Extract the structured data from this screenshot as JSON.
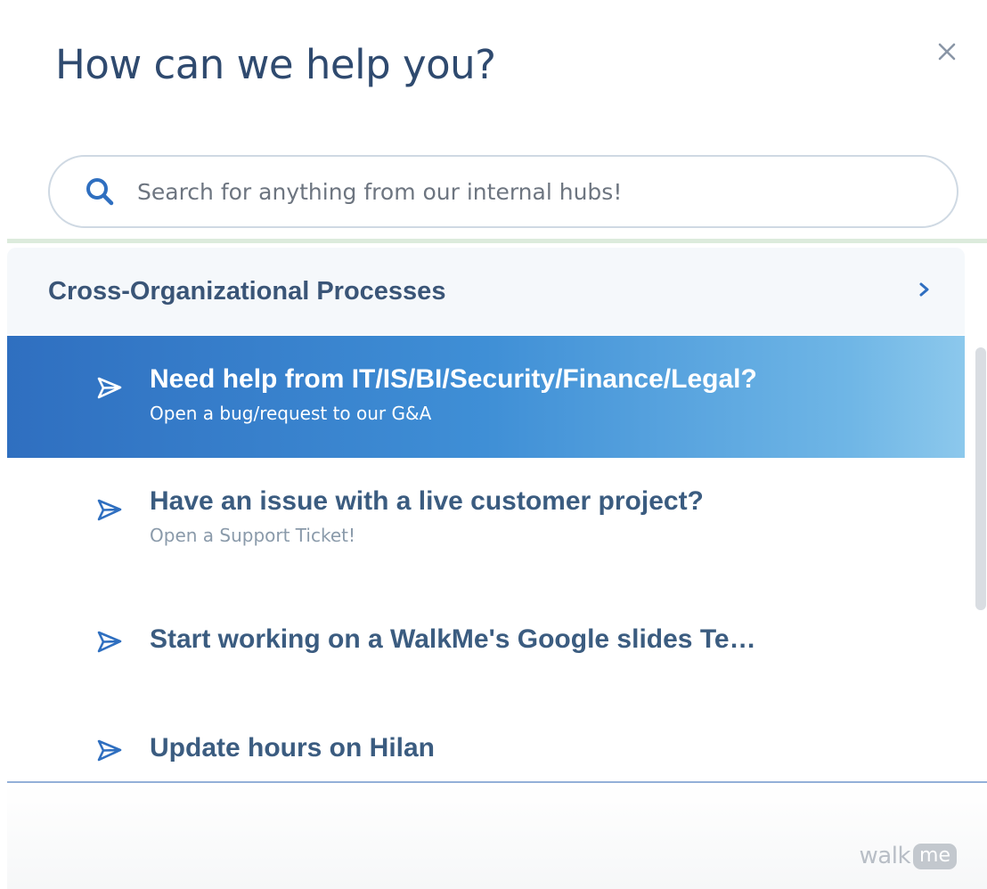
{
  "widget": {
    "title": "How can we help you?",
    "close_icon": "close-icon"
  },
  "search": {
    "placeholder": "Search for anything from our internal hubs!",
    "icon": "search-icon",
    "value": ""
  },
  "category": {
    "label": "Cross-Organizational Processes",
    "icon": "chevron-right-icon"
  },
  "items": [
    {
      "title": "Need help from IT/IS/BI/Security/Finance/Legal?",
      "subtitle": "Open a bug/request to our G&A",
      "active": true
    },
    {
      "title": "Have an issue with a live customer project?",
      "subtitle": "Open a Support Ticket!",
      "active": false
    },
    {
      "title": "Start working on a WalkMe's Google slides Te…",
      "subtitle": "",
      "active": false
    },
    {
      "title": "Update hours on Hilan",
      "subtitle": "",
      "active": false
    }
  ],
  "item_icon": "paper-plane-icon",
  "footer": {
    "brand_text": "walk",
    "brand_badge": "me"
  },
  "colors": {
    "title": "#2f4a6f",
    "accent": "#2f6fc0",
    "item_text": "#3b5c80",
    "search_icon": "#2f6fc0"
  }
}
